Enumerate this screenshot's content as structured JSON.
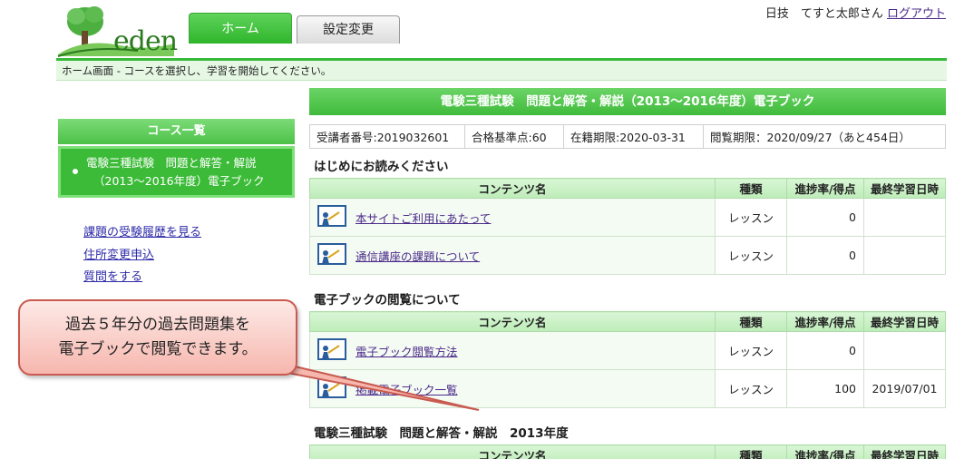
{
  "header": {
    "logo_text": "eden",
    "tabs": [
      {
        "label": "ホーム"
      },
      {
        "label": "設定変更"
      }
    ],
    "user_name": "日技　てすと太郎さん",
    "logout_label": "ログアウト",
    "instruction": "ホーム画面 - コースを選択し、学習を開始してください。"
  },
  "sidebar": {
    "course_list_title": "コース一覧",
    "courses": [
      {
        "line1": "電験三種試験　問題と解答・解説",
        "line2": "（2013～2016年度）電子ブック"
      }
    ],
    "links": [
      {
        "label": "課題の受験履歴を見る"
      },
      {
        "label": "住所変更申込"
      },
      {
        "label": "質問をする"
      }
    ]
  },
  "main": {
    "title": "電験三種試験　問題と解答・解説（2013～2016年度）電子ブック",
    "info": {
      "student_no": "受講者番号:2019032601",
      "pass_score": "合格基準点:60",
      "enrollment": "在籍期限:2020-03-31",
      "viewing": "閲覧期限：2020/09/27（あと454日）"
    },
    "columns": {
      "name": "コンテンツ名",
      "kind": "種類",
      "progress": "進捗率/得点",
      "last_date": "最終学習日時"
    },
    "sections": [
      {
        "title": "はじめにお読みください",
        "rows": [
          {
            "name": "本サイトご利用にあたって",
            "kind": "レッスン",
            "progress": "0",
            "date": ""
          },
          {
            "name": "通信講座の課題について",
            "kind": "レッスン",
            "progress": "0",
            "date": ""
          }
        ]
      },
      {
        "title": "電子ブックの閲覧について",
        "rows": [
          {
            "name": "電子ブック閲覧方法",
            "kind": "レッスン",
            "progress": "0",
            "date": ""
          },
          {
            "name": "掲載電子ブック一覧",
            "kind": "レッスン",
            "progress": "100",
            "date": "2019/07/01"
          }
        ]
      },
      {
        "title": "電験三種試験　問題と解答・解説　2013年度",
        "rows": []
      }
    ]
  },
  "callout": {
    "line1": "過去５年分の過去問題集を",
    "line2": "電子ブックで閲覧できます。"
  },
  "colors": {
    "accent_green": "#3cbb38",
    "callout_border": "#c95a4f"
  }
}
